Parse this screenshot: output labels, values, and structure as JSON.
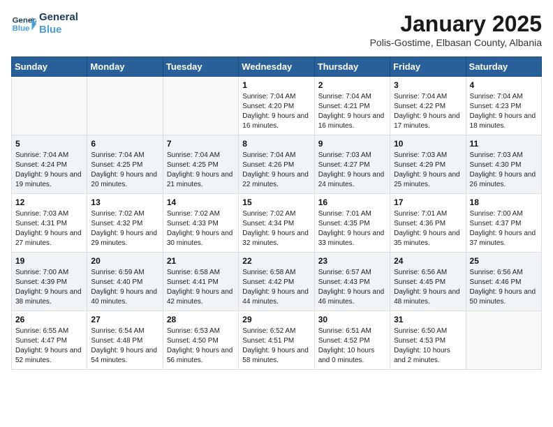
{
  "logo": {
    "line1": "General",
    "line2": "Blue"
  },
  "title": "January 2025",
  "subtitle": "Polis-Gostime, Elbasan County, Albania",
  "days_header": [
    "Sunday",
    "Monday",
    "Tuesday",
    "Wednesday",
    "Thursday",
    "Friday",
    "Saturday"
  ],
  "weeks": [
    [
      {
        "num": "",
        "info": ""
      },
      {
        "num": "",
        "info": ""
      },
      {
        "num": "",
        "info": ""
      },
      {
        "num": "1",
        "info": "Sunrise: 7:04 AM\nSunset: 4:20 PM\nDaylight: 9 hours and 16 minutes."
      },
      {
        "num": "2",
        "info": "Sunrise: 7:04 AM\nSunset: 4:21 PM\nDaylight: 9 hours and 16 minutes."
      },
      {
        "num": "3",
        "info": "Sunrise: 7:04 AM\nSunset: 4:22 PM\nDaylight: 9 hours and 17 minutes."
      },
      {
        "num": "4",
        "info": "Sunrise: 7:04 AM\nSunset: 4:23 PM\nDaylight: 9 hours and 18 minutes."
      }
    ],
    [
      {
        "num": "5",
        "info": "Sunrise: 7:04 AM\nSunset: 4:24 PM\nDaylight: 9 hours and 19 minutes."
      },
      {
        "num": "6",
        "info": "Sunrise: 7:04 AM\nSunset: 4:25 PM\nDaylight: 9 hours and 20 minutes."
      },
      {
        "num": "7",
        "info": "Sunrise: 7:04 AM\nSunset: 4:25 PM\nDaylight: 9 hours and 21 minutes."
      },
      {
        "num": "8",
        "info": "Sunrise: 7:04 AM\nSunset: 4:26 PM\nDaylight: 9 hours and 22 minutes."
      },
      {
        "num": "9",
        "info": "Sunrise: 7:03 AM\nSunset: 4:27 PM\nDaylight: 9 hours and 24 minutes."
      },
      {
        "num": "10",
        "info": "Sunrise: 7:03 AM\nSunset: 4:29 PM\nDaylight: 9 hours and 25 minutes."
      },
      {
        "num": "11",
        "info": "Sunrise: 7:03 AM\nSunset: 4:30 PM\nDaylight: 9 hours and 26 minutes."
      }
    ],
    [
      {
        "num": "12",
        "info": "Sunrise: 7:03 AM\nSunset: 4:31 PM\nDaylight: 9 hours and 27 minutes."
      },
      {
        "num": "13",
        "info": "Sunrise: 7:02 AM\nSunset: 4:32 PM\nDaylight: 9 hours and 29 minutes."
      },
      {
        "num": "14",
        "info": "Sunrise: 7:02 AM\nSunset: 4:33 PM\nDaylight: 9 hours and 30 minutes."
      },
      {
        "num": "15",
        "info": "Sunrise: 7:02 AM\nSunset: 4:34 PM\nDaylight: 9 hours and 32 minutes."
      },
      {
        "num": "16",
        "info": "Sunrise: 7:01 AM\nSunset: 4:35 PM\nDaylight: 9 hours and 33 minutes."
      },
      {
        "num": "17",
        "info": "Sunrise: 7:01 AM\nSunset: 4:36 PM\nDaylight: 9 hours and 35 minutes."
      },
      {
        "num": "18",
        "info": "Sunrise: 7:00 AM\nSunset: 4:37 PM\nDaylight: 9 hours and 37 minutes."
      }
    ],
    [
      {
        "num": "19",
        "info": "Sunrise: 7:00 AM\nSunset: 4:39 PM\nDaylight: 9 hours and 38 minutes."
      },
      {
        "num": "20",
        "info": "Sunrise: 6:59 AM\nSunset: 4:40 PM\nDaylight: 9 hours and 40 minutes."
      },
      {
        "num": "21",
        "info": "Sunrise: 6:58 AM\nSunset: 4:41 PM\nDaylight: 9 hours and 42 minutes."
      },
      {
        "num": "22",
        "info": "Sunrise: 6:58 AM\nSunset: 4:42 PM\nDaylight: 9 hours and 44 minutes."
      },
      {
        "num": "23",
        "info": "Sunrise: 6:57 AM\nSunset: 4:43 PM\nDaylight: 9 hours and 46 minutes."
      },
      {
        "num": "24",
        "info": "Sunrise: 6:56 AM\nSunset: 4:45 PM\nDaylight: 9 hours and 48 minutes."
      },
      {
        "num": "25",
        "info": "Sunrise: 6:56 AM\nSunset: 4:46 PM\nDaylight: 9 hours and 50 minutes."
      }
    ],
    [
      {
        "num": "26",
        "info": "Sunrise: 6:55 AM\nSunset: 4:47 PM\nDaylight: 9 hours and 52 minutes."
      },
      {
        "num": "27",
        "info": "Sunrise: 6:54 AM\nSunset: 4:48 PM\nDaylight: 9 hours and 54 minutes."
      },
      {
        "num": "28",
        "info": "Sunrise: 6:53 AM\nSunset: 4:50 PM\nDaylight: 9 hours and 56 minutes."
      },
      {
        "num": "29",
        "info": "Sunrise: 6:52 AM\nSunset: 4:51 PM\nDaylight: 9 hours and 58 minutes."
      },
      {
        "num": "30",
        "info": "Sunrise: 6:51 AM\nSunset: 4:52 PM\nDaylight: 10 hours and 0 minutes."
      },
      {
        "num": "31",
        "info": "Sunrise: 6:50 AM\nSunset: 4:53 PM\nDaylight: 10 hours and 2 minutes."
      },
      {
        "num": "",
        "info": ""
      }
    ]
  ]
}
